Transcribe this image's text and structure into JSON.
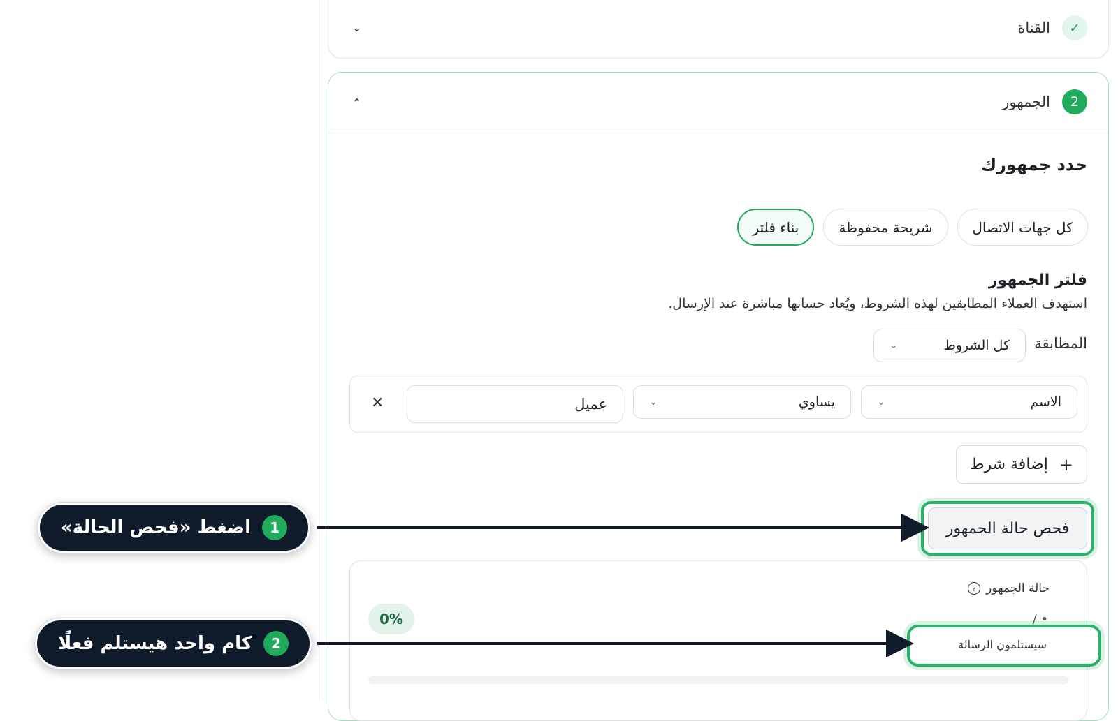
{
  "steps": {
    "channel": {
      "label": "القناة",
      "status_icon": "check-icon"
    },
    "audience": {
      "number": "2",
      "label": "الجمهور"
    }
  },
  "audience": {
    "title": "حدد جمهورك",
    "options": [
      {
        "label": "كل جهات الاتصال",
        "active": false
      },
      {
        "label": "شريحة محفوظة",
        "active": false
      },
      {
        "label": "بناء فلتر",
        "active": true
      }
    ],
    "filter": {
      "title": "فلتر الجمهور",
      "description": "استهدف العملاء المطابقين لهذه الشروط، ويُعاد حسابها مباشرة عند الإرسال.",
      "match_label": "المطابقة",
      "match_value": "كل الشروط",
      "condition": {
        "field": "الاسم",
        "operator": "يساوي",
        "value": "عميل"
      },
      "add_condition": "إضافة شرط"
    },
    "check_button": "فحص حالة الجمهور",
    "status": {
      "label": "حالة الجمهور",
      "percent": "0%",
      "count": "/ •",
      "recipients_text": "سيستلمون الرسالة",
      "progress": 0
    }
  },
  "callouts": [
    {
      "number": "1",
      "text": "اضغط «فحص الحالة»"
    },
    {
      "number": "2",
      "text": "كام واحد هيستلم فعلًا"
    }
  ],
  "colors": {
    "accent": "#1faa5c",
    "callout_bg": "#0f1a2a"
  }
}
